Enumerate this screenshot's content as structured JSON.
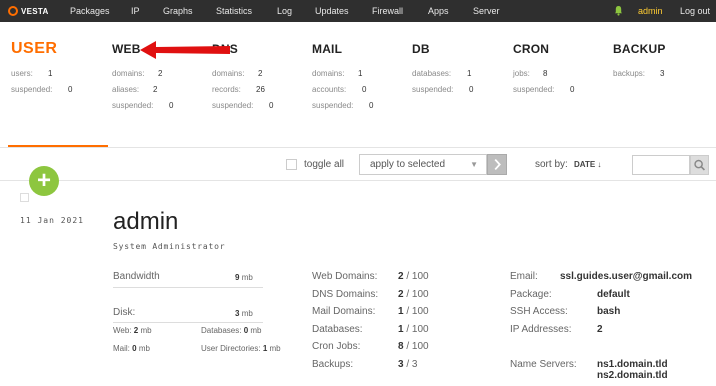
{
  "nav": {
    "logo": "VESTA",
    "items": [
      "Packages",
      "IP",
      "Graphs",
      "Statistics",
      "Log",
      "Updates",
      "Firewall",
      "Apps",
      "Server"
    ],
    "user": "admin",
    "logout": "Log out"
  },
  "columns": [
    {
      "title": "USER",
      "stats": [
        {
          "label": "users:",
          "value": "1"
        },
        {
          "label": "suspended:",
          "value": "0"
        }
      ]
    },
    {
      "title": "WEB",
      "stats": [
        {
          "label": "domains:",
          "value": "2"
        },
        {
          "label": "aliases:",
          "value": "2"
        },
        {
          "label": "suspended:",
          "value": "0"
        }
      ]
    },
    {
      "title": "DNS",
      "stats": [
        {
          "label": "domains:",
          "value": "2"
        },
        {
          "label": "records:",
          "value": "26"
        },
        {
          "label": "suspended:",
          "value": "0"
        }
      ]
    },
    {
      "title": "MAIL",
      "stats": [
        {
          "label": "domains:",
          "value": "1"
        },
        {
          "label": "accounts:",
          "value": "0"
        },
        {
          "label": "suspended:",
          "value": "0"
        }
      ]
    },
    {
      "title": "DB",
      "stats": [
        {
          "label": "databases:",
          "value": "1"
        },
        {
          "label": "suspended:",
          "value": "0"
        }
      ]
    },
    {
      "title": "CRON",
      "stats": [
        {
          "label": "jobs:",
          "value": "8"
        },
        {
          "label": "suspended:",
          "value": "0"
        }
      ]
    },
    {
      "title": "BACKUP",
      "stats": [
        {
          "label": "backups:",
          "value": "3"
        }
      ]
    }
  ],
  "toolbar": {
    "toggle_all": "toggle all",
    "apply_placeholder": "apply to selected",
    "sort_by": "sort by:",
    "sort_field": "DATE ↓"
  },
  "user": {
    "date": "11 Jan 2021",
    "name": "admin",
    "role": "System Administrator",
    "bandwidth_label": "Bandwidth",
    "bandwidth_value": "9",
    "bandwidth_unit": "mb",
    "disk_label": "Disk:",
    "disk_value": "3",
    "disk_unit": "mb",
    "web_label": "Web:",
    "web_value": "2",
    "web_unit": "mb",
    "databases_label": "Databases:",
    "databases_value": "0",
    "databases_unit": "mb",
    "mail_label": "Mail:",
    "mail_value": "0",
    "mail_unit": "mb",
    "userdirs_label": "User Directories:",
    "userdirs_value": "1",
    "userdirs_unit": "mb"
  },
  "limits": [
    {
      "label": "Web Domains:",
      "used": "2",
      "total": "/ 100"
    },
    {
      "label": "DNS Domains:",
      "used": "2",
      "total": "/ 100"
    },
    {
      "label": "Mail Domains:",
      "used": "1",
      "total": "/ 100"
    },
    {
      "label": "Databases:",
      "used": "1",
      "total": "/ 100"
    },
    {
      "label": "Cron Jobs:",
      "used": "8",
      "total": "/ 100"
    },
    {
      "label": "Backups:",
      "used": "3",
      "total": "/ 3"
    }
  ],
  "info": [
    {
      "label": "Email:",
      "value": "ssl.guides.user@gmail.com"
    },
    {
      "label": "Package:",
      "value": "default"
    },
    {
      "label": "SSH Access:",
      "value": "bash"
    },
    {
      "label": "IP Addresses:",
      "value": "2"
    }
  ],
  "name_servers": {
    "label": "Name Servers:",
    "values": [
      "ns1.domain.tld",
      "ns2.domain.tld"
    ]
  },
  "colors": {
    "accent": "#ff6e00",
    "add_button": "#8dc63f",
    "nav_bg": "#2f2f2f",
    "arrow": "#e01010"
  }
}
